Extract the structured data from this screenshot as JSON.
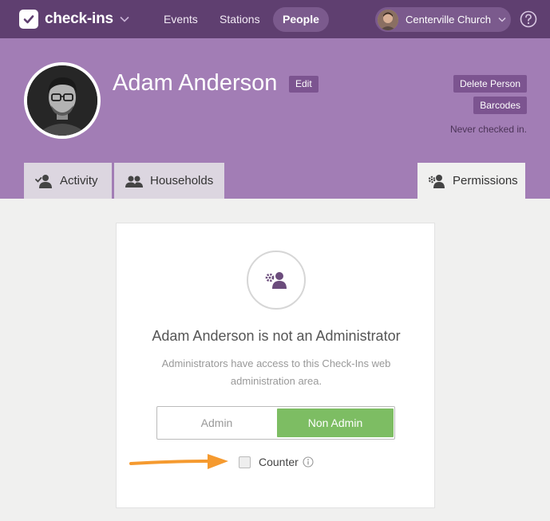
{
  "app": {
    "name": "check-ins"
  },
  "nav": {
    "items": [
      {
        "label": "Events"
      },
      {
        "label": "Stations"
      },
      {
        "label": "People",
        "active": true
      }
    ],
    "org": "Centerville Church"
  },
  "person": {
    "name": "Adam Anderson",
    "edit_label": "Edit",
    "delete_label": "Delete Person",
    "barcodes_label": "Barcodes",
    "checkin_status": "Never checked in."
  },
  "tabs": [
    {
      "label": "Activity",
      "icon": "person-check-icon"
    },
    {
      "label": "Households",
      "icon": "household-icon"
    },
    {
      "label": "Permissions",
      "icon": "person-gear-icon",
      "active": true
    }
  ],
  "permissions": {
    "title": "Adam Anderson is not an Administrator",
    "description": "Administrators have access to this Check-Ins web administration area.",
    "toggle": {
      "admin_label": "Admin",
      "non_admin_label": "Non Admin",
      "selected": "Non Admin"
    },
    "counter_label": "Counter",
    "counter_checked": false
  },
  "colors": {
    "nav_bg": "#5f3f70",
    "header_bg": "#a27db5",
    "accent_button": "#7c5490",
    "selected_toggle": "#7dbd63",
    "annotation_arrow": "#f59a2f"
  }
}
